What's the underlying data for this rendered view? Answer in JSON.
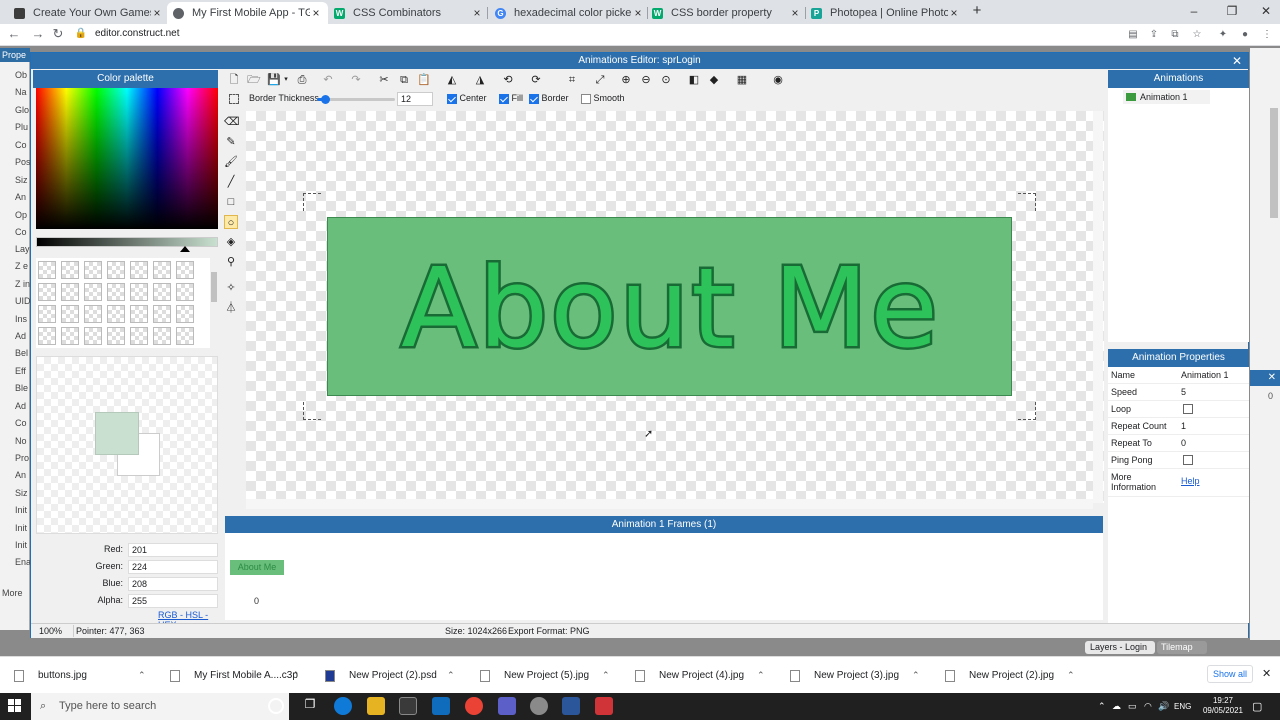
{
  "browser": {
    "tabs": [
      {
        "title": "Create Your Own Games - Free Tr",
        "icon": "construct-icon",
        "color": "#3c3c3c"
      },
      {
        "title": "My First Mobile App - TGG - Cor",
        "icon": "chrome-icon",
        "color": "#5f6368"
      },
      {
        "title": "CSS Combinators",
        "icon": "w3schools-icon",
        "color": "#04aa6d"
      },
      {
        "title": "hexadecimal color picker - Goog",
        "icon": "google-icon",
        "color": "#4285f4"
      },
      {
        "title": "CSS border property",
        "icon": "w3schools-icon",
        "color": "#04aa6d"
      },
      {
        "title": "Photopea | Online Photo Editor",
        "icon": "photopea-icon",
        "color": "#18a497"
      }
    ],
    "active_tab": 1,
    "url": "editor.construct.net"
  },
  "left_props": {
    "header": "Prope",
    "items": [
      "Ob",
      "Na",
      "Glo",
      "Plu",
      "Co",
      "Pos",
      "Siz",
      "An",
      "Op",
      "Co",
      "Lay",
      "Z e",
      "Z in",
      "UID",
      "Ins",
      "Ad",
      "Bel",
      "Eff",
      "Ble",
      "Ad",
      "Co",
      "No",
      "Pro",
      "An",
      "Siz",
      "Init",
      "Init",
      "Init",
      "Ena",
      "More"
    ]
  },
  "dialog": {
    "title": "Animations Editor: sprLogin",
    "color_palette": {
      "title": "Color palette",
      "red_label": "Red:",
      "red": "201",
      "green_label": "Green:",
      "green": "224",
      "blue_label": "Blue:",
      "blue": "208",
      "alpha_label": "Alpha:",
      "alpha": "255",
      "links": "RGB - HSL - HEX",
      "primary_color": "#c9e0d0"
    },
    "options": {
      "border_thickness_label": "Border Thickness",
      "border_thickness": "12",
      "border_thickness_slider": 0.1,
      "center_label": "Center",
      "center": true,
      "fill_label": "Fill",
      "fill": true,
      "border_label": "Border",
      "border": true,
      "smooth_label": "Smooth",
      "smooth": false
    },
    "sprite_text": "About Me",
    "frames": {
      "title": "Animation 1 Frames (1)",
      "frame_label": "About Me",
      "frame_index": "0"
    },
    "animations": {
      "title": "Animations",
      "items": [
        "Animation 1"
      ]
    },
    "properties": {
      "title": "Animation Properties",
      "rows": [
        {
          "key": "Name",
          "value": "Animation 1"
        },
        {
          "key": "Speed",
          "value": "5"
        },
        {
          "key": "Loop",
          "value": ""
        },
        {
          "key": "Repeat Count",
          "value": "1"
        },
        {
          "key": "Repeat To",
          "value": "0"
        },
        {
          "key": "Ping Pong",
          "value": ""
        },
        {
          "key": "More Information",
          "value": "Help"
        }
      ]
    },
    "status": {
      "zoom": "100%",
      "pointer": "Pointer: 477, 363",
      "size": "Size: 1024x266",
      "export": "Export Format: PNG"
    }
  },
  "underlying": {
    "layers_tab": "Layers - Login",
    "tilemap_tab": "Tilemap",
    "right_value": "0"
  },
  "downloads": {
    "items": [
      "buttons.jpg",
      "My First Mobile A....c3p",
      "New Project (2).psd",
      "New Project (5).jpg",
      "New Project (4).jpg",
      "New Project (3).jpg",
      "New Project (2).jpg"
    ],
    "show_all": "Show all"
  },
  "taskbar": {
    "search_placeholder": "Type here to search",
    "language": "ENG",
    "time": "19:27",
    "date": "09/05/2021"
  }
}
